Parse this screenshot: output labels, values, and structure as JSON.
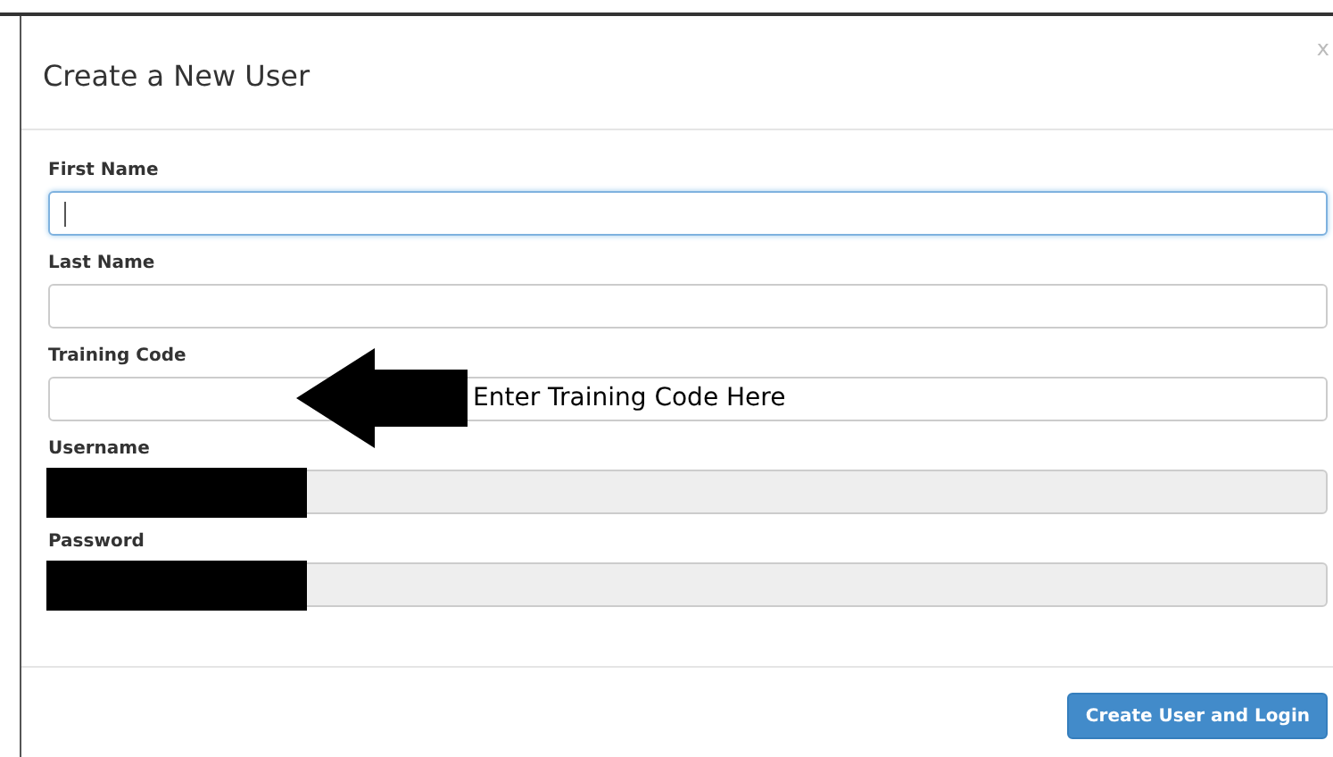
{
  "dialog": {
    "title": "Create a New User",
    "close": "x"
  },
  "fields": [
    {
      "label": "First Name",
      "focused": true,
      "disabled": false,
      "redacted": false
    },
    {
      "label": "Last Name",
      "focused": false,
      "disabled": false,
      "redacted": false
    },
    {
      "label": "Training Code",
      "focused": false,
      "disabled": false,
      "redacted": false,
      "annotation": "Enter Training Code Here"
    },
    {
      "label": "Username",
      "focused": false,
      "disabled": true,
      "redacted": true
    },
    {
      "label": "Password",
      "focused": false,
      "disabled": true,
      "redacted": true
    }
  ],
  "buttons": [
    "Create User and Login"
  ]
}
